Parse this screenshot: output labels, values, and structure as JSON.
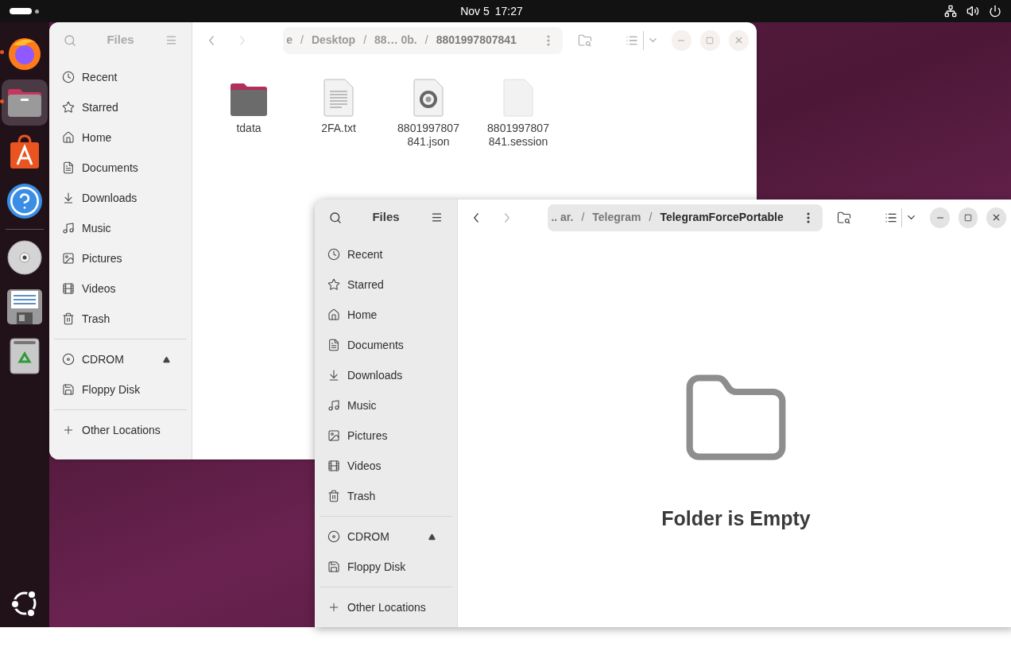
{
  "top_bar": {
    "date": "Nov 5",
    "time": "17:27"
  },
  "dock": [
    {
      "kind": "firefox",
      "running": true,
      "selected": false
    },
    {
      "kind": "files",
      "running": true,
      "selected": true
    },
    {
      "kind": "appcenter",
      "running": false,
      "selected": false
    },
    {
      "kind": "help",
      "running": false,
      "selected": false
    },
    {
      "kind": "cdrom",
      "running": false,
      "selected": false
    },
    {
      "kind": "floppy",
      "running": false,
      "selected": false
    },
    {
      "kind": "trash",
      "running": false,
      "selected": false
    }
  ],
  "windows": [
    {
      "active": false,
      "title": "Files",
      "separator": "/",
      "places": [
        "Recent",
        "Starred",
        "Home",
        "Documents",
        "Downloads",
        "Music",
        "Pictures",
        "Videos",
        "Trash"
      ],
      "devices": [
        {
          "label": "CDROM",
          "ejectable": true
        },
        {
          "label": "Floppy Disk",
          "ejectable": false
        }
      ],
      "other": "Other Locations",
      "path": [
        {
          "label": "e",
          "current": false
        },
        {
          "label": "Desktop",
          "current": false
        },
        {
          "label": "88… 0b.",
          "current": false
        },
        {
          "label": "8801997807841",
          "current": true
        }
      ],
      "files": [
        {
          "kind": "folder",
          "name": "tdata"
        },
        {
          "kind": "text",
          "name": "2FA.txt"
        },
        {
          "kind": "json",
          "name": "8801997807841.json"
        },
        {
          "kind": "blank",
          "name": "8801997807841.session"
        }
      ]
    },
    {
      "active": true,
      "title": "Files",
      "separator": "/",
      "places": [
        "Recent",
        "Starred",
        "Home",
        "Documents",
        "Downloads",
        "Music",
        "Pictures",
        "Videos",
        "Trash"
      ],
      "devices": [
        {
          "label": "CDROM",
          "ejectable": true
        },
        {
          "label": "Floppy Disk",
          "ejectable": false
        }
      ],
      "other": "Other Locations",
      "path": [
        {
          "label": ".. ar.",
          "current": false
        },
        {
          "label": "Telegram",
          "current": false
        },
        {
          "label": "TelegramForcePortable",
          "current": true
        }
      ],
      "empty_message": "Folder is Empty"
    }
  ]
}
